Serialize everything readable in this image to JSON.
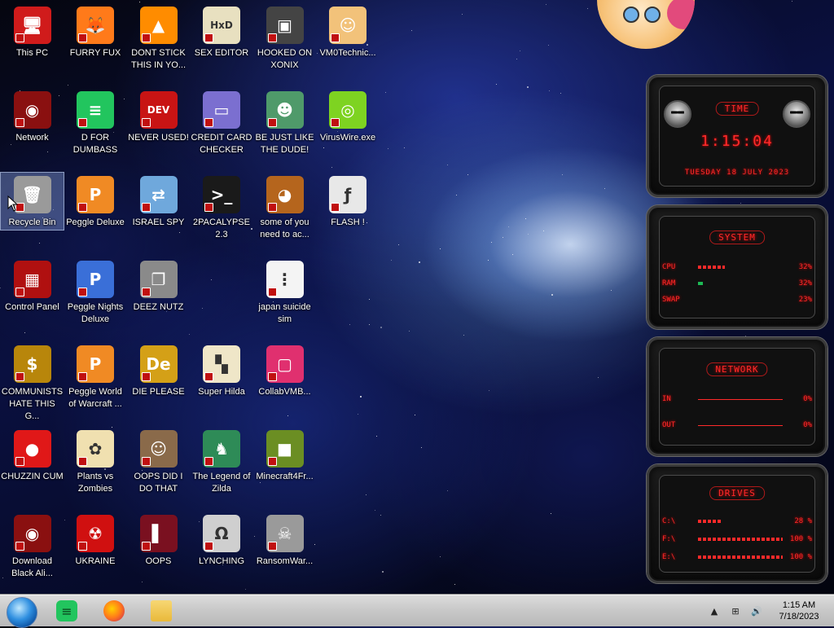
{
  "desktop_icons": [
    {
      "label": "This PC",
      "icon": "computer-icon",
      "color": "#d01b1b",
      "glyph": "🖥"
    },
    {
      "label": "FURRY FUX",
      "icon": "firefox-icon",
      "color": "#ff7a1a",
      "glyph": "🦊"
    },
    {
      "label": "DONT STICK THIS IN YO...",
      "icon": "vlc-cone-icon",
      "color": "#ff8c00",
      "glyph": "▲"
    },
    {
      "label": "SEX EDITOR",
      "icon": "hxd-editor-icon",
      "color": "#e8e0c0",
      "glyph": "HxD"
    },
    {
      "label": "HOOKED ON XONIX",
      "icon": "xonix-game-icon",
      "color": "#444444",
      "glyph": "▣"
    },
    {
      "label": "VM0Technic...",
      "icon": "doctor-icon",
      "color": "#f2c27a",
      "glyph": "☺"
    },
    {
      "label": "Network",
      "icon": "alien-network-icon",
      "color": "#8a1010",
      "glyph": "◉"
    },
    {
      "label": "D FOR DUMBASS",
      "icon": "chat-app-icon",
      "color": "#22c55e",
      "glyph": "≡"
    },
    {
      "label": "NEVER USED!",
      "icon": "devcpp-icon",
      "color": "#c81414",
      "glyph": "DEV"
    },
    {
      "label": "CREDIT CARD CHECKER",
      "icon": "credit-card-icon",
      "color": "#7b6fd0",
      "glyph": "▭"
    },
    {
      "label": "BE JUST LIKE THE DUDE!",
      "icon": "santa-portrait-icon",
      "color": "#4f9a6a",
      "glyph": "☻"
    },
    {
      "label": "VirusWire.exe",
      "icon": "limewire-icon",
      "color": "#7ed321",
      "glyph": "◎"
    },
    {
      "label": "Recycle Bin",
      "icon": "recycle-bin-icon",
      "color": "#9a9a9a",
      "glyph": "🗑"
    },
    {
      "label": "Peggle Deluxe",
      "icon": "peggle-icon",
      "color": "#f08a24",
      "glyph": "P"
    },
    {
      "label": "ISRAEL SPY",
      "icon": "network-spy-icon",
      "color": "#6fa8dc",
      "glyph": "⇄"
    },
    {
      "label": "2PACALYPSE 2.3",
      "icon": "terminal-icon",
      "color": "#1a1a1a",
      "glyph": ">_"
    },
    {
      "label": "some of you need to ac...",
      "icon": "dog-icon",
      "color": "#b5651d",
      "glyph": "◕"
    },
    {
      "label": "FLASH !",
      "icon": "flash-icon",
      "color": "#e8e8e8",
      "glyph": "ƒ"
    },
    {
      "label": "Control Panel",
      "icon": "control-panel-icon",
      "color": "#b01010",
      "glyph": "▦"
    },
    {
      "label": "Peggle Nights Deluxe",
      "icon": "peggle-nights-icon",
      "color": "#3a6fd8",
      "glyph": "P"
    },
    {
      "label": "DEEZ NUTZ",
      "icon": "stacked-windows-icon",
      "color": "#8a8a8a",
      "glyph": "❐"
    },
    {
      "label": "",
      "icon": "",
      "color": "",
      "glyph": ""
    },
    {
      "label": "japan suicide sim",
      "icon": "document-icon",
      "color": "#f4f4f4",
      "glyph": "⋮"
    },
    {
      "label": "",
      "icon": "",
      "color": "",
      "glyph": ""
    },
    {
      "label": "COMMUNISTS HATE THIS G...",
      "icon": "money-bag-icon",
      "color": "#b8860b",
      "glyph": "$"
    },
    {
      "label": "Peggle World of Warcraft ...",
      "icon": "peggle-wow-icon",
      "color": "#f08a24",
      "glyph": "P"
    },
    {
      "label": "DIE PLEASE",
      "icon": "de-icon",
      "color": "#d4a017",
      "glyph": "De"
    },
    {
      "label": "Super Hilda",
      "icon": "pixel-dog-icon",
      "color": "#efe6c8",
      "glyph": "▚"
    },
    {
      "label": "CollabVMB...",
      "icon": "monitor-icon",
      "color": "#e0306f",
      "glyph": "▢"
    },
    {
      "label": "",
      "icon": "",
      "color": "",
      "glyph": ""
    },
    {
      "label": "CHUZZIN CUM",
      "icon": "chuzzle-icon",
      "color": "#e01818",
      "glyph": "●"
    },
    {
      "label": "Plants vs Zombies",
      "icon": "flower-icon",
      "color": "#f0e0b0",
      "glyph": "✿"
    },
    {
      "label": "OOPS DID I DO THAT",
      "icon": "portrait-icon",
      "color": "#8a6a4a",
      "glyph": "☺"
    },
    {
      "label": "The Legend of Zilda",
      "icon": "pixel-hero-icon",
      "color": "#2e8b57",
      "glyph": "♞"
    },
    {
      "label": "Minecraft4Fr...",
      "icon": "grass-block-icon",
      "color": "#6b8e23",
      "glyph": "■"
    },
    {
      "label": "",
      "icon": "",
      "color": "",
      "glyph": ""
    },
    {
      "label": "Download Black Ali...",
      "icon": "alien-download-icon",
      "color": "#8a1010",
      "glyph": "◉"
    },
    {
      "label": "UKRAINE",
      "icon": "radiation-icon",
      "color": "#d01010",
      "glyph": "☢"
    },
    {
      "label": "OOPS",
      "icon": "book-icon",
      "color": "#7a1020",
      "glyph": "▌"
    },
    {
      "label": "LYNCHING",
      "icon": "noose-icon",
      "color": "#cfcfcf",
      "glyph": "Ω"
    },
    {
      "label": "RansomWar...",
      "icon": "skull-icon",
      "color": "#9a9a9a",
      "glyph": "☠"
    },
    {
      "label": "",
      "icon": "",
      "color": "",
      "glyph": ""
    }
  ],
  "gadget": {
    "time": {
      "title": "TIME",
      "clock": "1:15:04",
      "date": "TUESDAY 18 JULY 2023"
    },
    "system": {
      "title": "SYSTEM",
      "rows": [
        {
          "label": "CPU",
          "value": "32%",
          "level": 0.32
        },
        {
          "label": "RAM",
          "value": "32%",
          "level": 0.06
        },
        {
          "label": "SWAP",
          "value": "23%",
          "level": 0.0
        }
      ]
    },
    "network": {
      "title": "NETWORK",
      "rows": [
        {
          "label": "IN",
          "value": "0%"
        },
        {
          "label": "OUT",
          "value": "0%"
        }
      ]
    },
    "drives": {
      "title": "DRIVES",
      "rows": [
        {
          "label": "C:\\",
          "value": "28 %",
          "level": 0.28
        },
        {
          "label": "F:\\",
          "value": "100 %",
          "level": 1.0
        },
        {
          "label": "E:\\",
          "value": "100 %",
          "level": 1.0
        }
      ]
    },
    "accent": "#ff2a2a"
  },
  "taskbar": {
    "apps": [
      {
        "name": "start-orb"
      },
      {
        "name": "chat-app-icon",
        "color": "#22c55e"
      },
      {
        "name": "firefox-icon",
        "color": "#ff7a1a"
      },
      {
        "name": "file-explorer-icon",
        "color": "#f2c94c"
      }
    ],
    "tray": {
      "time": "1:15 AM",
      "date": "7/18/2023"
    }
  }
}
